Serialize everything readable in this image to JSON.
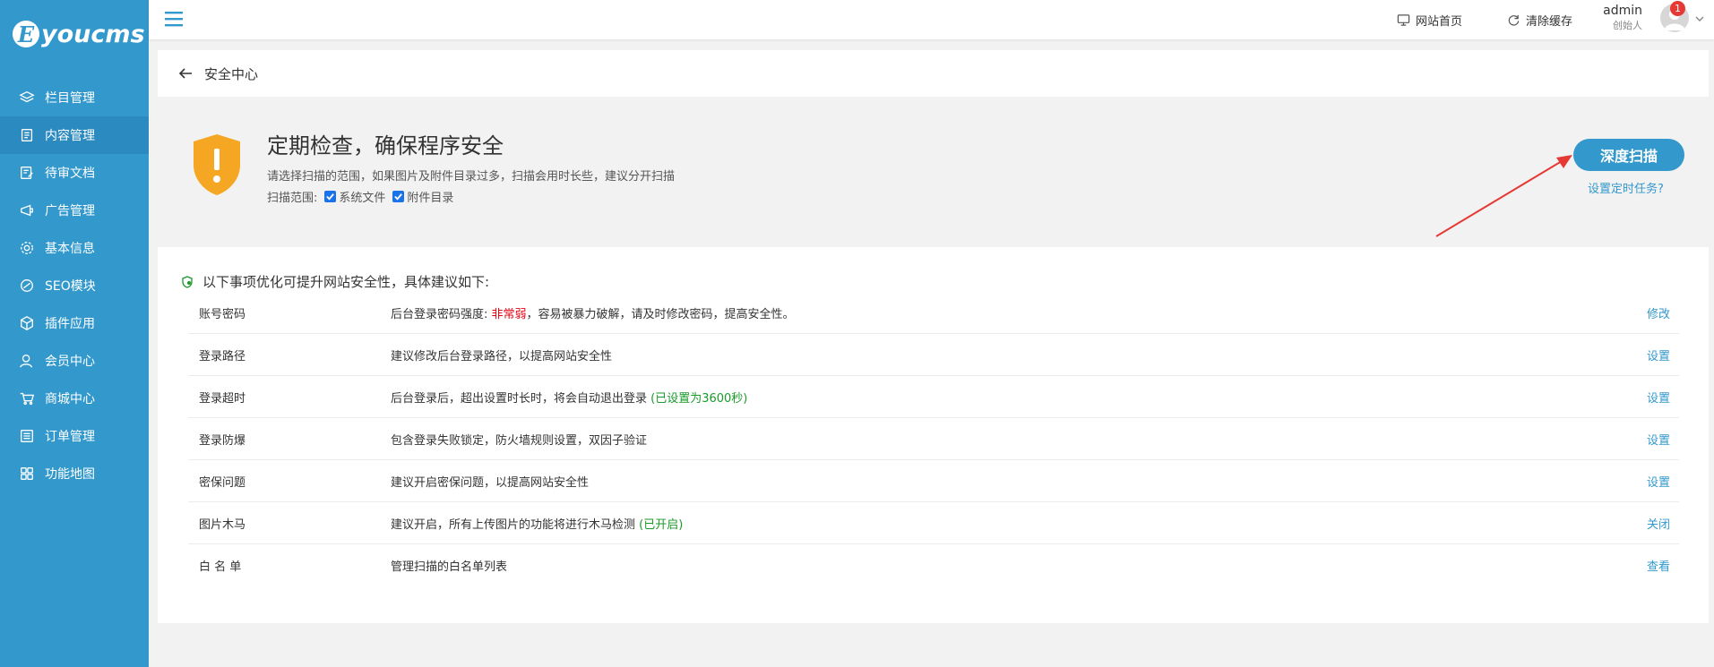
{
  "brand": {
    "logo_letter": "E",
    "logo_text": "youcms"
  },
  "sidebar": {
    "items": [
      {
        "label": "栏目管理",
        "icon": "layers-icon"
      },
      {
        "label": "内容管理",
        "icon": "document-icon",
        "active": true
      },
      {
        "label": "待审文档",
        "icon": "edit-doc-icon"
      },
      {
        "label": "广告管理",
        "icon": "ad-icon"
      },
      {
        "label": "基本信息",
        "icon": "gear-icon"
      },
      {
        "label": "SEO模块",
        "icon": "seo-icon"
      },
      {
        "label": "插件应用",
        "icon": "cube-icon"
      },
      {
        "label": "会员中心",
        "icon": "user-icon"
      },
      {
        "label": "商城中心",
        "icon": "cart-icon"
      },
      {
        "label": "订单管理",
        "icon": "list-icon"
      },
      {
        "label": "功能地图",
        "icon": "grid-icon"
      }
    ]
  },
  "topbar": {
    "home_label": "网站首页",
    "clear_cache_label": "清除缓存",
    "user_name": "admin",
    "user_role": "创始人",
    "notification_count": "1"
  },
  "page": {
    "title": "安全中心"
  },
  "scan": {
    "heading": "定期检查，确保程序安全",
    "description": "请选择扫描的范围，如果图片及附件目录过多，扫描会用时长些，建议分开扫描",
    "scope_label": "扫描范围:",
    "options": [
      {
        "label": "系统文件",
        "checked": true
      },
      {
        "label": "附件目录",
        "checked": true
      }
    ],
    "button_label": "深度扫描",
    "schedule_link": "设置定时任务?"
  },
  "suggestions": {
    "heading": "以下事项优化可提升网站安全性，具体建议如下:",
    "rows": [
      {
        "name": "账号密码",
        "desc_pre": "后台登录密码强度: ",
        "desc_highlight": "非常弱",
        "desc_post": "，容易被暴力破解，请及时修改密码，提高安全性。",
        "action": "修改"
      },
      {
        "name": "登录路径",
        "desc_pre": "建议修改后台登录路径，以提高网站安全性",
        "desc_highlight": "",
        "desc_post": "",
        "action": "设置"
      },
      {
        "name": "登录超时",
        "desc_pre": "后台登录后，超出设置时长时，将会自动退出登录 ",
        "desc_highlight": "(已设置为3600秒)",
        "desc_post": "",
        "action": "设置"
      },
      {
        "name": "登录防爆",
        "desc_pre": "包含登录失败锁定，防火墙规则设置，双因子验证",
        "desc_highlight": "",
        "desc_post": "",
        "action": "设置"
      },
      {
        "name": "密保问题",
        "desc_pre": "建议开启密保问题，以提高网站安全性",
        "desc_highlight": "",
        "desc_post": "",
        "action": "设置"
      },
      {
        "name": "图片木马",
        "desc_pre": "建议开启，所有上传图片的功能将进行木马检测 ",
        "desc_highlight": "(已开启)",
        "desc_post": "",
        "action": "关闭"
      },
      {
        "name": "白 名 单",
        "desc_pre": "管理扫描的白名单列表",
        "desc_highlight": "",
        "desc_post": "",
        "action": "查看"
      }
    ]
  },
  "colors": {
    "primary": "#3398cc",
    "danger": "#e60012",
    "success": "#1a9a2a",
    "shield": "#f5a623"
  }
}
